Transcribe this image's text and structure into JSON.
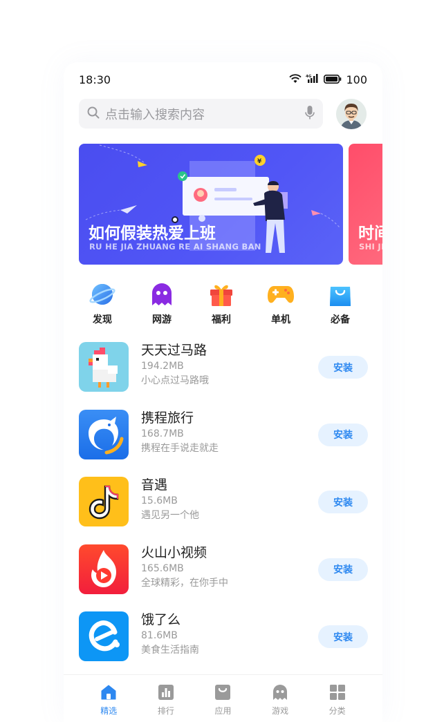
{
  "status_bar": {
    "time": "18:30",
    "network": "4G",
    "battery": "100"
  },
  "search": {
    "placeholder": "点击输入搜索内容"
  },
  "banners": [
    {
      "title": "如何假装热爱上班",
      "subtitle": "RU HE JIA ZHUANG RE AI SHANG BAN",
      "color": "#4a4df0"
    },
    {
      "title": "时间",
      "subtitle": "SHI JI",
      "color": "#ff4d6a"
    }
  ],
  "categories": [
    {
      "label": "发现",
      "icon": "planet-icon",
      "color": "#3a8ff5"
    },
    {
      "label": "网游",
      "icon": "ghost-icon",
      "color": "#8a2be2"
    },
    {
      "label": "福利",
      "icon": "gift-icon",
      "color": "#f0463c"
    },
    {
      "label": "单机",
      "icon": "gamepad-icon",
      "color": "#ffb01f"
    },
    {
      "label": "必备",
      "icon": "shopping-bag-icon",
      "color": "#2aa6f5"
    }
  ],
  "apps": [
    {
      "name": "天天过马路",
      "size": "194.2MB",
      "desc": "小心点过马路哦",
      "button": "安装",
      "icon": "chicken-icon"
    },
    {
      "name": "携程旅行",
      "size": "168.7MB",
      "desc": "携程在手说走就走",
      "button": "安装",
      "icon": "dolphin-icon"
    },
    {
      "name": "音遇",
      "size": "15.6MB",
      "desc": "遇见另一个他",
      "button": "安装",
      "icon": "music-note-icon"
    },
    {
      "name": "火山小视频",
      "size": "165.6MB",
      "desc": "全球精彩，在你手中",
      "button": "安装",
      "icon": "flame-play-icon"
    },
    {
      "name": "饿了么",
      "size": "81.6MB",
      "desc": "美食生活指南",
      "button": "安装",
      "icon": "eleme-icon"
    }
  ],
  "tabs": [
    {
      "label": "精选",
      "icon": "home-icon",
      "active": true
    },
    {
      "label": "排行",
      "icon": "rank-icon",
      "active": false
    },
    {
      "label": "应用",
      "icon": "app-bag-icon",
      "active": false
    },
    {
      "label": "游戏",
      "icon": "ghost-icon",
      "active": false
    },
    {
      "label": "分类",
      "icon": "grid-icon",
      "active": false
    }
  ],
  "colors": {
    "accent": "#2d88f0",
    "install_bg": "#e6f2ff",
    "tab_inactive": "#9a9a9a"
  }
}
